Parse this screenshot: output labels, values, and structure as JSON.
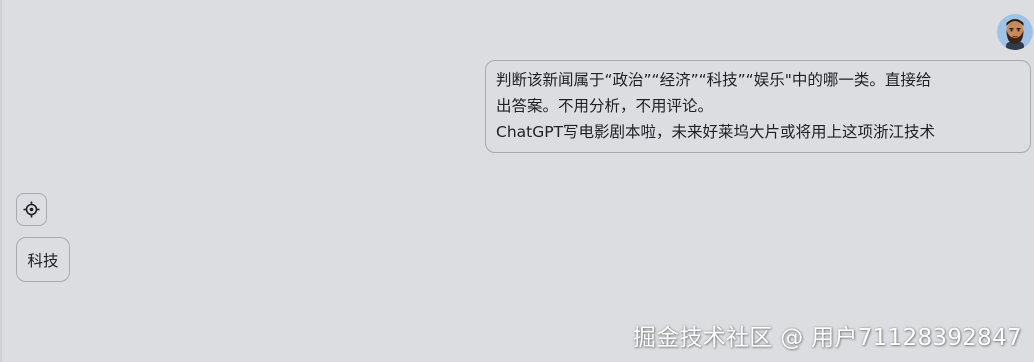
{
  "conversation": {
    "user_message": {
      "lines": [
        "判断该新闻属于“政治”“经济”“科技”“娱乐\"中的哪一类。直接给",
        "出答案。不用分析，不用评论。",
        "ChatGPT写电影剧本啦，未来好莱坞大片或将用上这项浙江技术"
      ],
      "avatar_icon": "bearded-man-avatar-icon"
    },
    "bot_reply": {
      "icon": "crosshair-icon",
      "text": "科技"
    }
  },
  "watermark": "掘金技术社区 @ 用户7112839284​7",
  "colors": {
    "background": "#dcdde1",
    "bubble_border": "#a9aab0",
    "text": "#1f1f24"
  }
}
